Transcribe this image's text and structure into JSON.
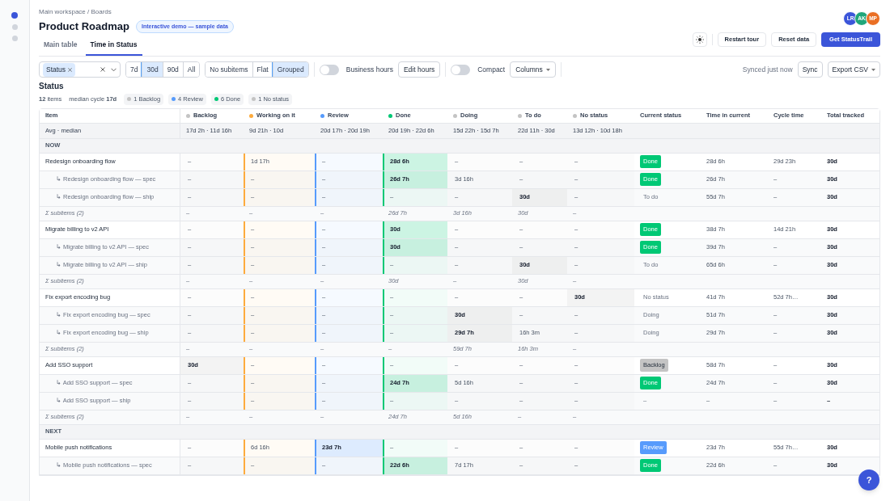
{
  "sidebar": {
    "items": [
      {
        "selected": true
      },
      {
        "selected": false
      },
      {
        "selected": false
      }
    ]
  },
  "breadcrumb": "Main workspace / Boards",
  "title": "Product Roadmap",
  "demo_badge": "Interactive demo — sample data",
  "avatars": [
    {
      "initials": "LR",
      "color": "#3b55d9"
    },
    {
      "initials": "AK",
      "color": "#1fa67a"
    },
    {
      "initials": "MP",
      "color": "#ea6f24"
    }
  ],
  "tabs": [
    {
      "label": "Main table",
      "selected": false
    },
    {
      "label": "Time in Status",
      "selected": true
    }
  ],
  "actions": [
    {
      "label": "Restart tour",
      "kind": "secondary"
    },
    {
      "label": "Reset data",
      "kind": "secondary"
    },
    {
      "label": "Get StatusTrail",
      "kind": "primary"
    }
  ],
  "filters": {
    "status_chip": "Status",
    "ranges": [
      {
        "label": "7d",
        "selected": false
      },
      {
        "label": "30d",
        "selected": true
      },
      {
        "label": "90d",
        "selected": false
      },
      {
        "label": "All",
        "selected": false
      }
    ],
    "subitem_modes": [
      {
        "label": "No subitems",
        "selected": false
      },
      {
        "label": "Flat",
        "selected": false
      },
      {
        "label": "Grouped",
        "selected": true
      }
    ],
    "business_hours": {
      "label": "Business hours",
      "on": false
    },
    "edit_hours": "Edit hours",
    "compact": {
      "label": "Compact",
      "on": false
    },
    "columns": "Columns",
    "sync_note": "Synced just now",
    "sync": "Sync",
    "export": "Export CSV"
  },
  "summary": {
    "heading": "Status",
    "items": "**12** items",
    "median": "median cycle **17d**",
    "chips": [
      {
        "label": "1 Backlog",
        "color": "#c4c4c4"
      },
      {
        "label": "4 Review",
        "color": "#579bfc"
      },
      {
        "label": "6 Done",
        "color": "#00c875"
      },
      {
        "label": "1 No status",
        "color": "#c4c4c4"
      }
    ]
  },
  "table": {
    "item_header": "Item",
    "status_columns": [
      {
        "label": "Backlog",
        "color": "#c4c4c4"
      },
      {
        "label": "Working on it",
        "color": "#fdab3d"
      },
      {
        "label": "Review",
        "color": "#579bfc"
      },
      {
        "label": "Done",
        "color": "#00c875"
      },
      {
        "label": "Doing",
        "color": "#c4c4c4"
      },
      {
        "label": "To do",
        "color": "#c4c4c4"
      },
      {
        "label": "No status",
        "color": "#c4c4c4"
      }
    ],
    "extra_columns": [
      "Current status",
      "Time in current",
      "Cycle time",
      "Total tracked"
    ],
    "avg_row": {
      "label": "Avg · median",
      "values": [
        "17d 2h · 11d 16h",
        "9d 21h · 10d",
        "20d 17h · 20d 19h",
        "20d 19h · 22d 6h",
        "15d 22h · 15d 7h",
        "22d 11h · 30d",
        "13d 12h · 10d 18h"
      ]
    },
    "rows": [
      {
        "kind": "section",
        "label": "NOW"
      },
      {
        "kind": "item",
        "name": "Redesign onboarding flow",
        "times": [
          "–",
          "1d 17h",
          "–",
          "28d 6h",
          "–",
          "–",
          "–"
        ],
        "bold": [
          false,
          false,
          false,
          true,
          false,
          false,
          false
        ],
        "status": {
          "text": "Done",
          "color": "#00c875"
        },
        "time_in_current": "28d 6h",
        "cycle_time": "29d 23h",
        "total": "30d"
      },
      {
        "kind": "subitem",
        "name": "↳ Redesign onboarding flow — spec",
        "times": [
          "–",
          "–",
          "–",
          "26d 7h",
          "3d 16h",
          "–",
          "–"
        ],
        "bold": [
          false,
          false,
          false,
          true,
          false,
          false,
          false
        ],
        "status": {
          "text": "Done",
          "color": "#00c875"
        },
        "time_in_current": "26d 7h",
        "cycle_time": "–",
        "total": "30d"
      },
      {
        "kind": "subitem",
        "name": "↳ Redesign onboarding flow — ship",
        "times": [
          "–",
          "–",
          "–",
          "–",
          "–",
          "30d",
          "–"
        ],
        "bold": [
          false,
          false,
          false,
          false,
          false,
          true,
          false
        ],
        "status": {
          "text": "To do"
        },
        "time_in_current": "55d 7h",
        "cycle_time": "–",
        "total": "30d"
      },
      {
        "kind": "subtotal",
        "label": "Σ subitems (2)",
        "times": [
          "–",
          "–",
          "–",
          "26d 7h",
          "3d 16h",
          "30d",
          "–"
        ]
      },
      {
        "kind": "item",
        "name": "Migrate billing to v2 API",
        "times": [
          "–",
          "–",
          "–",
          "30d",
          "–",
          "–",
          "–"
        ],
        "bold": [
          false,
          false,
          false,
          true,
          false,
          false,
          false
        ],
        "status": {
          "text": "Done",
          "color": "#00c875"
        },
        "time_in_current": "38d 7h",
        "cycle_time": "14d 21h",
        "total": "30d"
      },
      {
        "kind": "subitem",
        "name": "↳ Migrate billing to v2 API — spec",
        "times": [
          "–",
          "–",
          "–",
          "30d",
          "–",
          "–",
          "–"
        ],
        "bold": [
          false,
          false,
          false,
          true,
          false,
          false,
          false
        ],
        "status": {
          "text": "Done",
          "color": "#00c875"
        },
        "time_in_current": "39d 7h",
        "cycle_time": "–",
        "total": "30d"
      },
      {
        "kind": "subitem",
        "name": "↳ Migrate billing to v2 API — ship",
        "times": [
          "–",
          "–",
          "–",
          "–",
          "–",
          "30d",
          "–"
        ],
        "bold": [
          false,
          false,
          false,
          false,
          false,
          true,
          false
        ],
        "status": {
          "text": "To do"
        },
        "time_in_current": "65d 6h",
        "cycle_time": "–",
        "total": "30d"
      },
      {
        "kind": "subtotal",
        "label": "Σ subitems (2)",
        "times": [
          "–",
          "–",
          "–",
          "30d",
          "–",
          "30d",
          "–"
        ]
      },
      {
        "kind": "item",
        "name": "Fix export encoding bug",
        "times": [
          "–",
          "–",
          "–",
          "–",
          "–",
          "–",
          "30d"
        ],
        "bold": [
          false,
          false,
          false,
          false,
          false,
          false,
          true
        ],
        "status": {
          "text": "No status"
        },
        "time_in_current": "41d 7h",
        "cycle_time": "52d 7h…",
        "total": "30d"
      },
      {
        "kind": "subitem",
        "name": "↳ Fix export encoding bug — spec",
        "times": [
          "–",
          "–",
          "–",
          "–",
          "30d",
          "–",
          "–"
        ],
        "bold": [
          false,
          false,
          false,
          false,
          true,
          false,
          false
        ],
        "status": {
          "text": "Doing"
        },
        "time_in_current": "51d 7h",
        "cycle_time": "–",
        "total": "30d"
      },
      {
        "kind": "subitem",
        "name": "↳ Fix export encoding bug — ship",
        "times": [
          "–",
          "–",
          "–",
          "–",
          "29d 7h",
          "16h 3m",
          "–"
        ],
        "bold": [
          false,
          false,
          false,
          false,
          true,
          false,
          false
        ],
        "status": {
          "text": "Doing"
        },
        "time_in_current": "29d 7h",
        "cycle_time": "–",
        "total": "30d"
      },
      {
        "kind": "subtotal",
        "label": "Σ subitems (2)",
        "times": [
          "–",
          "–",
          "–",
          "–",
          "59d 7h",
          "16h 3m",
          "–"
        ]
      },
      {
        "kind": "item",
        "name": "Add SSO support",
        "times": [
          "30d",
          "–",
          "–",
          "–",
          "–",
          "–",
          "–"
        ],
        "bold": [
          true,
          false,
          false,
          false,
          false,
          false,
          false
        ],
        "status": {
          "text": "Backlog",
          "color": "#c4c4c4"
        },
        "time_in_current": "58d 7h",
        "cycle_time": "–",
        "total": "30d"
      },
      {
        "kind": "subitem",
        "name": "↳ Add SSO support — spec",
        "times": [
          "–",
          "–",
          "–",
          "24d 7h",
          "5d 16h",
          "–",
          "–"
        ],
        "bold": [
          false,
          false,
          false,
          true,
          false,
          false,
          false
        ],
        "status": {
          "text": "Done",
          "color": "#00c875"
        },
        "time_in_current": "24d 7h",
        "cycle_time": "–",
        "total": "30d"
      },
      {
        "kind": "subitem",
        "name": "↳ Add SSO support — ship",
        "times": [
          "–",
          "–",
          "–",
          "–",
          "–",
          "–",
          "–"
        ],
        "bold": [
          false,
          false,
          false,
          false,
          false,
          false,
          false
        ],
        "status": {
          "text": "–"
        },
        "time_in_current": "–",
        "cycle_time": "–",
        "total": "–"
      },
      {
        "kind": "subtotal",
        "label": "Σ subitems (2)",
        "times": [
          "–",
          "–",
          "–",
          "24d 7h",
          "5d 16h",
          "–",
          "–"
        ]
      },
      {
        "kind": "section",
        "label": "NEXT"
      },
      {
        "kind": "item",
        "name": "Mobile push notifications",
        "times": [
          "–",
          "6d 16h",
          "23d 7h",
          "–",
          "–",
          "–",
          "–"
        ],
        "bold": [
          false,
          false,
          true,
          false,
          false,
          false,
          false
        ],
        "status": {
          "text": "Review",
          "color": "#579bfc"
        },
        "time_in_current": "23d 7h",
        "cycle_time": "55d 7h…",
        "total": "30d"
      },
      {
        "kind": "subitem",
        "name": "↳ Mobile push notifications — spec",
        "times": [
          "–",
          "–",
          "–",
          "22d 6h",
          "7d 17h",
          "–",
          "–"
        ],
        "bold": [
          false,
          false,
          false,
          true,
          false,
          false,
          false
        ],
        "status": {
          "text": "Done",
          "color": "#00c875"
        },
        "time_in_current": "22d 6h",
        "cycle_time": "–",
        "total": "30d"
      }
    ]
  },
  "help_button": "?"
}
